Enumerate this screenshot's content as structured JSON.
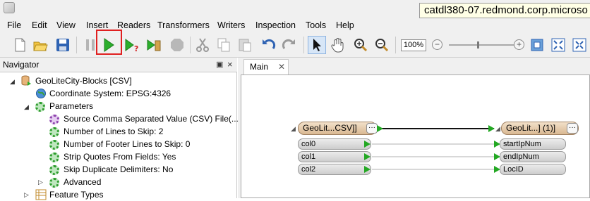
{
  "window": {
    "title": "catdl380-07.redmond.corp.microso"
  },
  "menu": [
    "File",
    "Edit",
    "View",
    "Insert",
    "Readers",
    "Transformers",
    "Writers",
    "Inspection",
    "Tools",
    "Help"
  ],
  "toolbar": {
    "icons": [
      "new-icon",
      "open-icon",
      "save-icon",
      "pause-icon",
      "run-icon",
      "run-with-prompt-icon",
      "run-to-icon",
      "stop-icon",
      "cut-icon",
      "copy-icon",
      "paste-icon",
      "undo-icon",
      "redo-icon",
      "select-icon",
      "pan-icon",
      "zoom-in-icon",
      "zoom-out-icon",
      "fit-icon",
      "overview-icon",
      "expand-icon"
    ],
    "zoom_value": "100%",
    "zoom_minus": "−",
    "zoom_plus": "+"
  },
  "navigator": {
    "title": "Navigator",
    "pin": "▣",
    "close": "×",
    "root": "GeoLiteCity-Blocks [CSV]",
    "coord": "Coordinate System: EPSG:4326",
    "parameters": "Parameters",
    "params": [
      "Source Comma Separated Value (CSV) File(...",
      "Number of Lines to Skip: 2",
      "Number of Footer Lines to Skip: 0",
      "Strip Quotes From Fields: Yes",
      "Skip Duplicate Delimiters: No",
      "Advanced"
    ],
    "feature_types": "Feature Types"
  },
  "main": {
    "tab_label": "Main",
    "tab_close": "✕",
    "reader": {
      "label": "GeoLit...CSV]]",
      "dots": "···",
      "attrs": [
        "col0",
        "col1",
        "col2"
      ]
    },
    "writer": {
      "label": "GeoLit...] (1)]",
      "dots": "···",
      "attrs": [
        "startIpNum",
        "endIpNum",
        "LocID"
      ]
    }
  },
  "colors": {
    "port_green": "#23a823",
    "highlight_red": "#e02020",
    "reader_header": "#d9b892"
  }
}
